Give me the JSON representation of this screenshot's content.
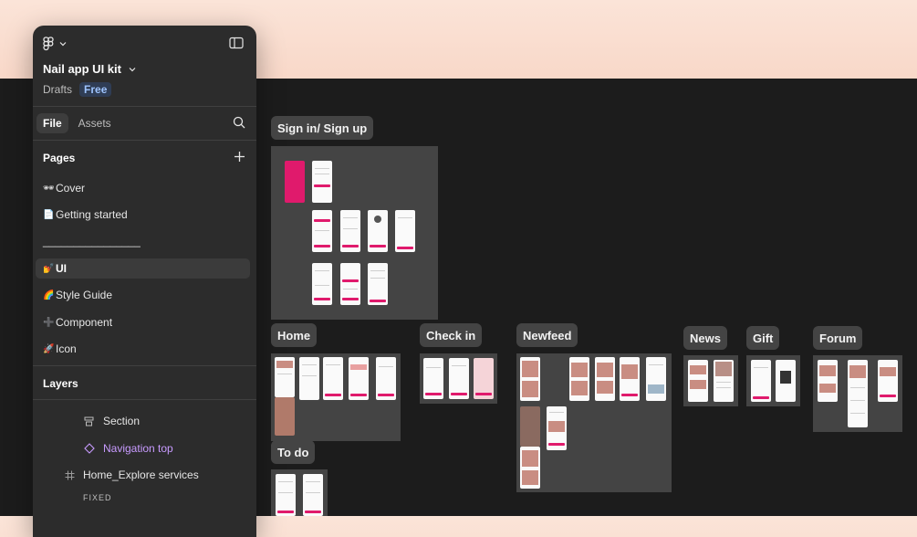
{
  "file": {
    "name": "Nail app UI kit",
    "location": "Drafts",
    "plan": "Free"
  },
  "tabs": {
    "file": "File",
    "assets": "Assets"
  },
  "pages": {
    "heading": "Pages",
    "items": [
      {
        "emoji": "🕶",
        "label": "Cover"
      },
      {
        "emoji": "📄",
        "label": "Getting started"
      },
      {
        "emoji": "",
        "label": "________________"
      },
      {
        "emoji": "💅",
        "label": "UI",
        "selected": true
      },
      {
        "emoji": "🌈",
        "label": "Style Guide"
      },
      {
        "emoji": "➕",
        "label": "Component"
      },
      {
        "emoji": "🚀",
        "label": "Icon"
      }
    ]
  },
  "layers": {
    "heading": "Layers",
    "items": [
      {
        "type": "section",
        "label": "Section"
      },
      {
        "type": "component",
        "label": "Navigation top"
      },
      {
        "type": "frame",
        "label": "Home_Explore services"
      }
    ],
    "fixed_label": "FIXED"
  },
  "canvas": {
    "sections": [
      {
        "id": "signin",
        "label": "Sign in/ Sign up"
      },
      {
        "id": "home",
        "label": "Home"
      },
      {
        "id": "checkin",
        "label": "Check in"
      },
      {
        "id": "newfeed",
        "label": "Newfeed"
      },
      {
        "id": "news",
        "label": "News"
      },
      {
        "id": "gift",
        "label": "Gift"
      },
      {
        "id": "forum",
        "label": "Forum"
      },
      {
        "id": "todo",
        "label": "To do"
      }
    ]
  },
  "colors": {
    "accent": "#e01a6c",
    "panel": "#2c2c2c",
    "canvas": "#1c1c1c",
    "section": "#444444"
  }
}
